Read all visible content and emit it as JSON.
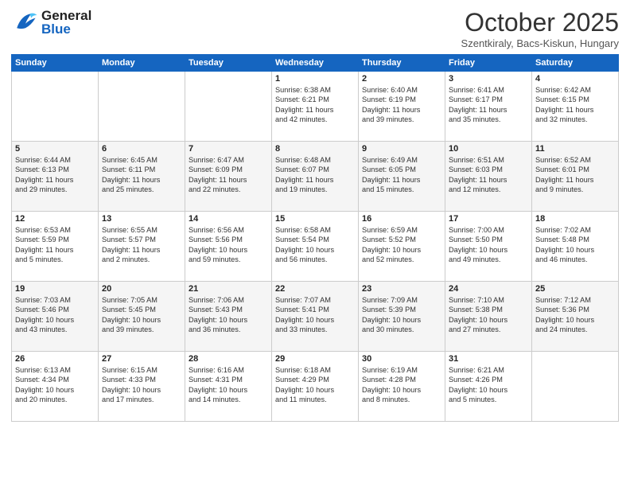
{
  "header": {
    "logo_general": "General",
    "logo_blue": "Blue",
    "title": "October 2025",
    "subtitle": "Szentkiraly, Bacs-Kiskun, Hungary"
  },
  "weekdays": [
    "Sunday",
    "Monday",
    "Tuesday",
    "Wednesday",
    "Thursday",
    "Friday",
    "Saturday"
  ],
  "weeks": [
    [
      {
        "day": "",
        "lines": []
      },
      {
        "day": "",
        "lines": []
      },
      {
        "day": "",
        "lines": []
      },
      {
        "day": "1",
        "lines": [
          "Sunrise: 6:38 AM",
          "Sunset: 6:21 PM",
          "Daylight: 11 hours",
          "and 42 minutes."
        ]
      },
      {
        "day": "2",
        "lines": [
          "Sunrise: 6:40 AM",
          "Sunset: 6:19 PM",
          "Daylight: 11 hours",
          "and 39 minutes."
        ]
      },
      {
        "day": "3",
        "lines": [
          "Sunrise: 6:41 AM",
          "Sunset: 6:17 PM",
          "Daylight: 11 hours",
          "and 35 minutes."
        ]
      },
      {
        "day": "4",
        "lines": [
          "Sunrise: 6:42 AM",
          "Sunset: 6:15 PM",
          "Daylight: 11 hours",
          "and 32 minutes."
        ]
      }
    ],
    [
      {
        "day": "5",
        "lines": [
          "Sunrise: 6:44 AM",
          "Sunset: 6:13 PM",
          "Daylight: 11 hours",
          "and 29 minutes."
        ]
      },
      {
        "day": "6",
        "lines": [
          "Sunrise: 6:45 AM",
          "Sunset: 6:11 PM",
          "Daylight: 11 hours",
          "and 25 minutes."
        ]
      },
      {
        "day": "7",
        "lines": [
          "Sunrise: 6:47 AM",
          "Sunset: 6:09 PM",
          "Daylight: 11 hours",
          "and 22 minutes."
        ]
      },
      {
        "day": "8",
        "lines": [
          "Sunrise: 6:48 AM",
          "Sunset: 6:07 PM",
          "Daylight: 11 hours",
          "and 19 minutes."
        ]
      },
      {
        "day": "9",
        "lines": [
          "Sunrise: 6:49 AM",
          "Sunset: 6:05 PM",
          "Daylight: 11 hours",
          "and 15 minutes."
        ]
      },
      {
        "day": "10",
        "lines": [
          "Sunrise: 6:51 AM",
          "Sunset: 6:03 PM",
          "Daylight: 11 hours",
          "and 12 minutes."
        ]
      },
      {
        "day": "11",
        "lines": [
          "Sunrise: 6:52 AM",
          "Sunset: 6:01 PM",
          "Daylight: 11 hours",
          "and 9 minutes."
        ]
      }
    ],
    [
      {
        "day": "12",
        "lines": [
          "Sunrise: 6:53 AM",
          "Sunset: 5:59 PM",
          "Daylight: 11 hours",
          "and 5 minutes."
        ]
      },
      {
        "day": "13",
        "lines": [
          "Sunrise: 6:55 AM",
          "Sunset: 5:57 PM",
          "Daylight: 11 hours",
          "and 2 minutes."
        ]
      },
      {
        "day": "14",
        "lines": [
          "Sunrise: 6:56 AM",
          "Sunset: 5:56 PM",
          "Daylight: 10 hours",
          "and 59 minutes."
        ]
      },
      {
        "day": "15",
        "lines": [
          "Sunrise: 6:58 AM",
          "Sunset: 5:54 PM",
          "Daylight: 10 hours",
          "and 56 minutes."
        ]
      },
      {
        "day": "16",
        "lines": [
          "Sunrise: 6:59 AM",
          "Sunset: 5:52 PM",
          "Daylight: 10 hours",
          "and 52 minutes."
        ]
      },
      {
        "day": "17",
        "lines": [
          "Sunrise: 7:00 AM",
          "Sunset: 5:50 PM",
          "Daylight: 10 hours",
          "and 49 minutes."
        ]
      },
      {
        "day": "18",
        "lines": [
          "Sunrise: 7:02 AM",
          "Sunset: 5:48 PM",
          "Daylight: 10 hours",
          "and 46 minutes."
        ]
      }
    ],
    [
      {
        "day": "19",
        "lines": [
          "Sunrise: 7:03 AM",
          "Sunset: 5:46 PM",
          "Daylight: 10 hours",
          "and 43 minutes."
        ]
      },
      {
        "day": "20",
        "lines": [
          "Sunrise: 7:05 AM",
          "Sunset: 5:45 PM",
          "Daylight: 10 hours",
          "and 39 minutes."
        ]
      },
      {
        "day": "21",
        "lines": [
          "Sunrise: 7:06 AM",
          "Sunset: 5:43 PM",
          "Daylight: 10 hours",
          "and 36 minutes."
        ]
      },
      {
        "day": "22",
        "lines": [
          "Sunrise: 7:07 AM",
          "Sunset: 5:41 PM",
          "Daylight: 10 hours",
          "and 33 minutes."
        ]
      },
      {
        "day": "23",
        "lines": [
          "Sunrise: 7:09 AM",
          "Sunset: 5:39 PM",
          "Daylight: 10 hours",
          "and 30 minutes."
        ]
      },
      {
        "day": "24",
        "lines": [
          "Sunrise: 7:10 AM",
          "Sunset: 5:38 PM",
          "Daylight: 10 hours",
          "and 27 minutes."
        ]
      },
      {
        "day": "25",
        "lines": [
          "Sunrise: 7:12 AM",
          "Sunset: 5:36 PM",
          "Daylight: 10 hours",
          "and 24 minutes."
        ]
      }
    ],
    [
      {
        "day": "26",
        "lines": [
          "Sunrise: 6:13 AM",
          "Sunset: 4:34 PM",
          "Daylight: 10 hours",
          "and 20 minutes."
        ]
      },
      {
        "day": "27",
        "lines": [
          "Sunrise: 6:15 AM",
          "Sunset: 4:33 PM",
          "Daylight: 10 hours",
          "and 17 minutes."
        ]
      },
      {
        "day": "28",
        "lines": [
          "Sunrise: 6:16 AM",
          "Sunset: 4:31 PM",
          "Daylight: 10 hours",
          "and 14 minutes."
        ]
      },
      {
        "day": "29",
        "lines": [
          "Sunrise: 6:18 AM",
          "Sunset: 4:29 PM",
          "Daylight: 10 hours",
          "and 11 minutes."
        ]
      },
      {
        "day": "30",
        "lines": [
          "Sunrise: 6:19 AM",
          "Sunset: 4:28 PM",
          "Daylight: 10 hours",
          "and 8 minutes."
        ]
      },
      {
        "day": "31",
        "lines": [
          "Sunrise: 6:21 AM",
          "Sunset: 4:26 PM",
          "Daylight: 10 hours",
          "and 5 minutes."
        ]
      },
      {
        "day": "",
        "lines": []
      }
    ]
  ]
}
